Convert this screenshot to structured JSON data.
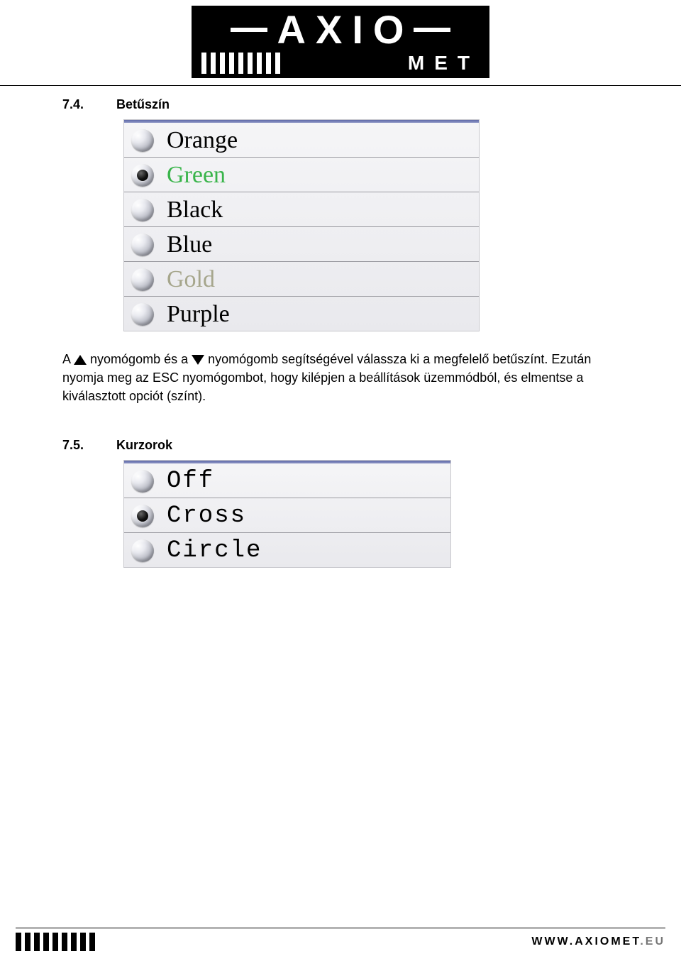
{
  "brand": {
    "name": "AXIOMET",
    "top_letters": [
      "A",
      "X",
      "I",
      "O"
    ],
    "bottom_word": "MET"
  },
  "section1": {
    "number": "7.4.",
    "title": "Betűszín",
    "options": [
      {
        "label": "Orange",
        "selected": false,
        "style": "serif"
      },
      {
        "label": "Green",
        "selected": true,
        "style": "green-serif"
      },
      {
        "label": "Black",
        "selected": false,
        "style": "serif"
      },
      {
        "label": "Blue",
        "selected": false,
        "style": "serif"
      },
      {
        "label": "Gold",
        "selected": false,
        "style": "gold-serif"
      },
      {
        "label": "Purple",
        "selected": false,
        "style": "serif"
      }
    ],
    "paragraph": {
      "pre_up": "A ",
      "between": " nyomógomb és a ",
      "post_down": " nyomógomb segítségével válassza ki a megfelelő betűszínt. Ezután nyomja meg az ESC nyomógombot, hogy kilépjen a beállítások üzemmódból, és elmentse a kiválasztott opciót (színt)."
    }
  },
  "section2": {
    "number": "7.5.",
    "title": "Kurzorok",
    "options": [
      {
        "label": "Off",
        "selected": false
      },
      {
        "label": "Cross",
        "selected": true
      },
      {
        "label": "Circle",
        "selected": false
      }
    ]
  },
  "footer": {
    "url_main": "WWW.AXIOMET",
    "url_tld": ".EU"
  }
}
